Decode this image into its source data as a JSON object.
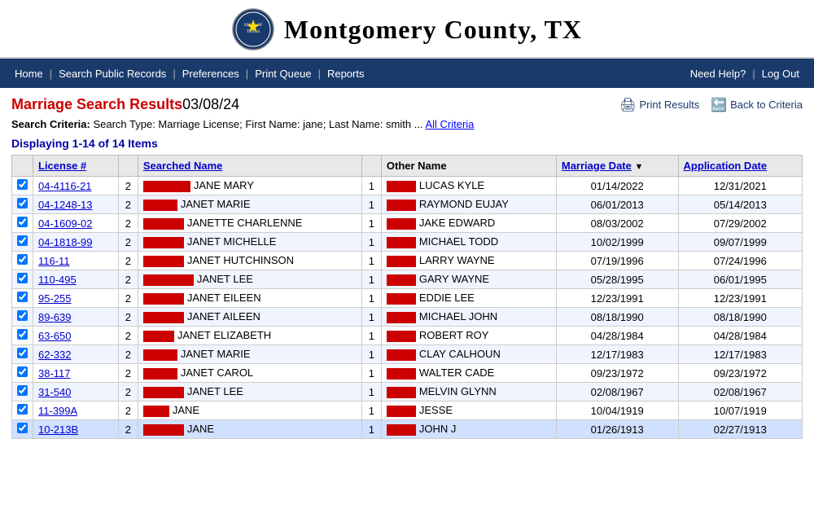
{
  "header": {
    "county_name": "Montgomery County, TX",
    "logo_alt": "Montgomery County seal"
  },
  "nav": {
    "left_items": [
      {
        "label": "Home",
        "id": "home"
      },
      {
        "label": "Search Public Records",
        "id": "search-public-records"
      },
      {
        "label": "Preferences",
        "id": "preferences"
      },
      {
        "label": "Print Queue",
        "id": "print-queue"
      },
      {
        "label": "Reports",
        "id": "reports"
      }
    ],
    "right_items": [
      {
        "label": "Need Help?",
        "id": "need-help"
      },
      {
        "label": "Log Out",
        "id": "log-out"
      }
    ]
  },
  "page": {
    "title": "Marriage Search Results",
    "date": "03/08/24",
    "print_label": "Print Results",
    "back_label": "Back to Criteria",
    "search_criteria_label": "Search Criteria:",
    "search_criteria_text": "Search Type: Marriage License; First Name: jane; Last Name: smith ...",
    "all_criteria_label": "All Criteria",
    "display_count": "Displaying 1-14 of 14 Items"
  },
  "table": {
    "columns": [
      {
        "key": "cb",
        "label": ""
      },
      {
        "key": "license",
        "label": "License #"
      },
      {
        "key": "num1",
        "label": ""
      },
      {
        "key": "searched_name",
        "label": "Searched Name"
      },
      {
        "key": "num2",
        "label": ""
      },
      {
        "key": "other_name",
        "label": "Other Name"
      },
      {
        "key": "marriage_date",
        "label": "Marriage Date"
      },
      {
        "key": "app_date",
        "label": "Application Date"
      }
    ],
    "rows": [
      {
        "license": "04-4116-21",
        "n1": 2,
        "searched_name": "JANE MARY",
        "redact_w": 58,
        "n2": 1,
        "other_name": "LUCAS KYLE",
        "marriage_date": "01/14/2022",
        "app_date": "12/31/2021",
        "highlight": false
      },
      {
        "license": "04-1248-13",
        "n1": 2,
        "searched_name": "JANET MARIE",
        "redact_w": 42,
        "n2": 1,
        "other_name": "RAYMOND EUJAY",
        "marriage_date": "06/01/2013",
        "app_date": "05/14/2013",
        "highlight": false
      },
      {
        "license": "04-1609-02",
        "n1": 2,
        "searched_name": "JANETTE CHARLENNE",
        "redact_w": 50,
        "n2": 1,
        "other_name": "JAKE EDWARD",
        "marriage_date": "08/03/2002",
        "app_date": "07/29/2002",
        "highlight": false
      },
      {
        "license": "04-1818-99",
        "n1": 2,
        "searched_name": "JANET MICHELLE",
        "redact_w": 50,
        "n2": 1,
        "other_name": "MICHAEL TODD",
        "marriage_date": "10/02/1999",
        "app_date": "09/07/1999",
        "highlight": false
      },
      {
        "license": "116-11",
        "n1": 2,
        "searched_name": "JANET HUTCHINSON",
        "redact_w": 50,
        "n2": 1,
        "other_name": "LARRY WAYNE",
        "marriage_date": "07/19/1996",
        "app_date": "07/24/1996",
        "highlight": false
      },
      {
        "license": "110-495",
        "n1": 2,
        "searched_name": "JANET LEE",
        "redact_w": 62,
        "n2": 1,
        "other_name": "GARY WAYNE",
        "marriage_date": "05/28/1995",
        "app_date": "06/01/1995",
        "highlight": false
      },
      {
        "license": "95-255",
        "n1": 2,
        "searched_name": "JANET EILEEN",
        "redact_w": 50,
        "n2": 1,
        "other_name": "EDDIE LEE",
        "marriage_date": "12/23/1991",
        "app_date": "12/23/1991",
        "highlight": false
      },
      {
        "license": "89-639",
        "n1": 2,
        "searched_name": "JANET AILEEN",
        "redact_w": 50,
        "n2": 1,
        "other_name": "MICHAEL JOHN",
        "marriage_date": "08/18/1990",
        "app_date": "08/18/1990",
        "highlight": false
      },
      {
        "license": "63-650",
        "n1": 2,
        "searched_name": "JANET ELIZABETH",
        "redact_w": 38,
        "n2": 1,
        "other_name": "ROBERT ROY",
        "marriage_date": "04/28/1984",
        "app_date": "04/28/1984",
        "highlight": false
      },
      {
        "license": "62-332",
        "n1": 2,
        "searched_name": "JANET MARIE",
        "redact_w": 42,
        "n2": 1,
        "other_name": "CLAY CALHOUN",
        "marriage_date": "12/17/1983",
        "app_date": "12/17/1983",
        "highlight": false
      },
      {
        "license": "38-117",
        "n1": 2,
        "searched_name": "JANET CAROL",
        "redact_w": 42,
        "n2": 1,
        "other_name": "WALTER CADE",
        "marriage_date": "09/23/1972",
        "app_date": "09/23/1972",
        "highlight": false
      },
      {
        "license": "31-540",
        "n1": 2,
        "searched_name": "JANET LEE",
        "redact_w": 50,
        "n2": 1,
        "other_name": "MELVIN GLYNN",
        "marriage_date": "02/08/1967",
        "app_date": "02/08/1967",
        "highlight": false
      },
      {
        "license": "11-399A",
        "n1": 2,
        "searched_name": "JANE",
        "redact_w": 32,
        "n2": 1,
        "other_name": "JESSE",
        "marriage_date": "10/04/1919",
        "app_date": "10/07/1919",
        "highlight": false
      },
      {
        "license": "10-213B",
        "n1": 2,
        "searched_name": "JANE",
        "redact_w": 50,
        "n2": 1,
        "other_name": "JOHN J",
        "marriage_date": "01/26/1913",
        "app_date": "02/27/1913",
        "highlight": true
      }
    ]
  }
}
